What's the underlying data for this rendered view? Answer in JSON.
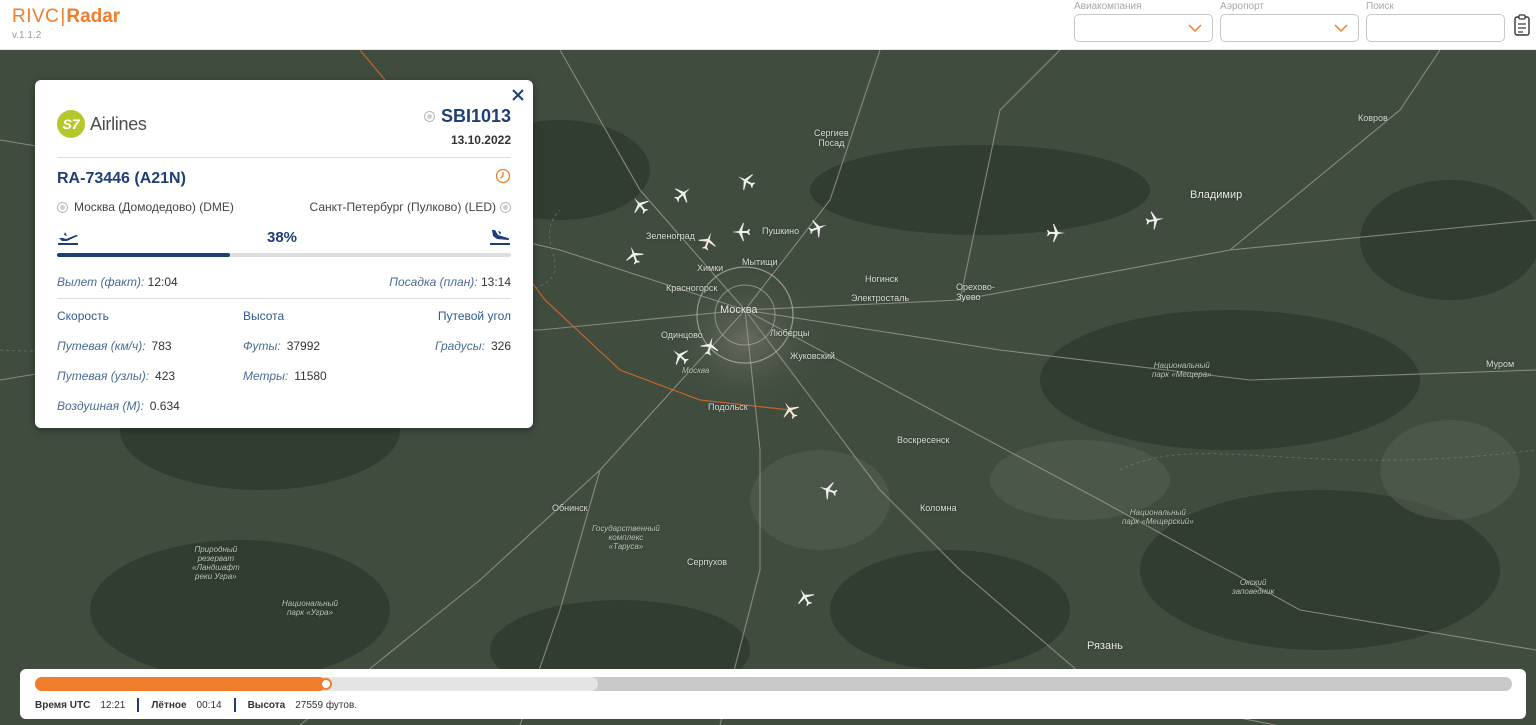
{
  "header": {
    "brand_left": "RIVC",
    "brand_right": "Radar",
    "version": "v.1.1.2",
    "airline_filter_label": "Авиакомпания",
    "airport_filter_label": "Аэропорт",
    "search_label": "Поиск",
    "airline_filter_value": "",
    "airport_filter_value": "",
    "search_value": ""
  },
  "map": {
    "places": {
      "sergiev_posad": "Сергиев\nПосад",
      "vladimir": "Владимир",
      "kovrov": "Ковров",
      "zelenograd": "Зеленоград",
      "pushkino": "Пушкино",
      "khimki": "Химки",
      "mytishchi": "Мытищи",
      "krasnogorsk": "Красногорск",
      "noginsk": "Ногинск",
      "elektrostal": "Электросталь",
      "orekhovo": "Орехово-\nЗуево",
      "moskva": "Москва",
      "odintsovo": "Одинцово",
      "lyubertsy": "Люберцы",
      "moskva_small": "Москва",
      "zhukovsky": "Жуковский",
      "podolsk": "Подольск",
      "voskresensk": "Воскресенск",
      "meshchera": "Национальный\nпарк «Мещера»",
      "murom": "Муром",
      "obninsk": "Обнинск",
      "kolomna": "Коломна",
      "meshchersky": "Национальный\nпарк «Мещерский»",
      "tarusa": "Государственный\nкомплекс\n«Таруса»",
      "serpukhov": "Серпухов",
      "ugra_reserve": "Природный\nрезерват\n«Ландшафт\nреки Угра»",
      "ugra_park": "Национальный\nпарк «Угра»",
      "oksky": "Окский\nзаповедник",
      "ryazan": "Рязань"
    }
  },
  "flight_card": {
    "airline_logo_letter": "S7",
    "airline_name": "Airlines",
    "flight_number": "SBI1013",
    "date": "13.10.2022",
    "registration": "RA-73446 (A21N)",
    "origin": "Москва (Домодедово) (DME)",
    "destination": "Санкт-Петербург (Пулково) (LED)",
    "progress_label": "38%",
    "progress": 0.38,
    "departure_label": "Вылет (факт):",
    "departure_time": "12:04",
    "arrival_label": "Посадка (план):",
    "arrival_time": "13:14",
    "speed_header": "Скорость",
    "altitude_header": "Высота",
    "track_header": "Путевой угол",
    "ground_kmh_label": "Путевая (км/ч):",
    "ground_kmh": "783",
    "ground_knots_label": "Путевая (узлы):",
    "ground_knots": "423",
    "air_mach_label": "Воздушная (М):",
    "air_mach": "0.634",
    "feet_label": "Футы:",
    "feet": "37992",
    "meters_label": "Метры:",
    "meters": "11580",
    "degrees_label": "Градусы:",
    "degrees": "326"
  },
  "timeline": {
    "played_fraction": 0.197,
    "loaded_fraction": 0.381,
    "utc_label": "Время UTC",
    "utc_value": "12:21",
    "flight_label": "Лётное",
    "flight_value": "00:14",
    "alt_label": "Высота",
    "alt_value": "27559 футов."
  },
  "colors": {
    "brand": "#ef7d2c",
    "navy": "#1f3e73",
    "s7": "#b4c82d",
    "map_bg": "#3d4a3c"
  }
}
